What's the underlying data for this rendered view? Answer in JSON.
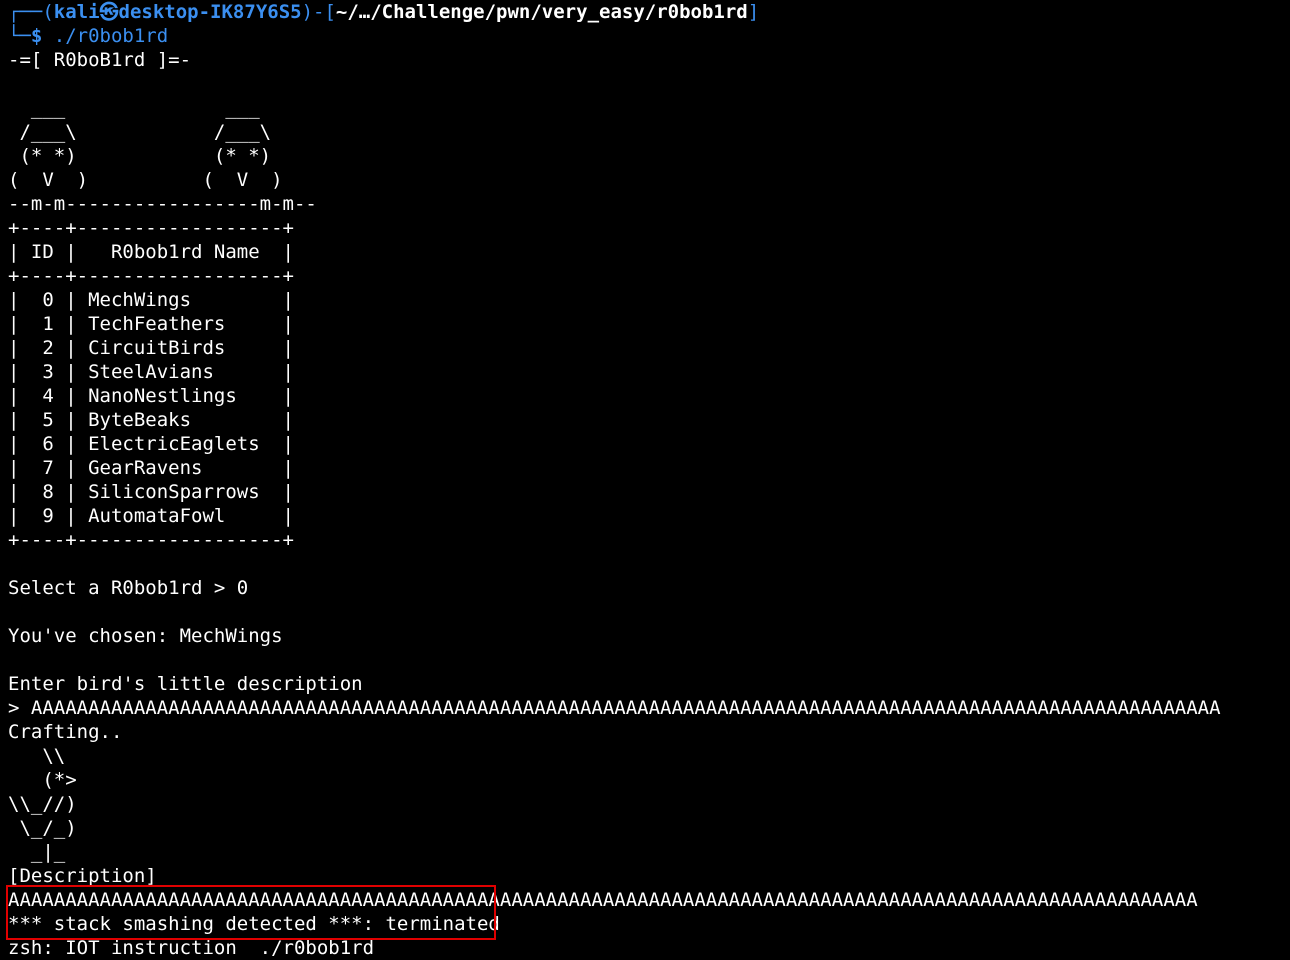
{
  "prompt": {
    "corner_top": "┌──(",
    "user": "kali",
    "at_glyph": "㉿",
    "host": "desktop-IK87Y6S5",
    "sep_open": ")-[",
    "path": "~/…/Challenge/pwn/very_easy/r0bob1rd",
    "sep_close": "]",
    "corner_bottom": "└─",
    "dollar": "$",
    "command": "./r0bob1rd"
  },
  "banner": "-=[ R0boB1rd ]=-",
  "ascii_art": [
    "",
    "  ___              ___",
    " /___\\            /___\\",
    " (* *)            (* *)",
    "(  V  )          (  V  )",
    "--m-m-----------------m-m--"
  ],
  "table": {
    "border": "+----+------------------+",
    "header": "| ID |   R0bob1rd Name  |",
    "rows": [
      "|  0 | MechWings        |",
      "|  1 | TechFeathers     |",
      "|  2 | CircuitBirds     |",
      "|  3 | SteelAvians      |",
      "|  4 | NanoNestlings    |",
      "|  5 | ByteBeaks        |",
      "|  6 | ElectricEaglets  |",
      "|  7 | GearRavens       |",
      "|  8 | SiliconSparrows  |",
      "|  9 | AutomataFowl     |"
    ]
  },
  "interaction": {
    "select_prompt": "Select a R0bob1rd > 0",
    "chosen": "You've chosen: MechWings",
    "enter_desc": "Enter bird's little description",
    "input_line": "> AAAAAAAAAAAAAAAAAAAAAAAAAAAAAAAAAAAAAAAAAAAAAAAAAAAAAAAAAAAAAAAAAAAAAAAAAAAAAAAAAAAAAAAAAAAAAAAAAAAAAAAA",
    "crafting": "Crafting..",
    "bird_art": [
      "   \\\\",
      "   (*>",
      "\\\\_//)",
      " \\_/_)",
      "  _|_"
    ],
    "desc_label": "[Description]",
    "desc_value": "AAAAAAAAAAAAAAAAAAAAAAAAAAAAAAAAAAAAAAAAAAAAAAAAAAAAAAAAAAAAAAAAAAAAAAAAAAAAAAAAAAAAAAAAAAAAAAAAAAAAAAAA"
  },
  "error": {
    "line1": "*** stack smashing detected ***: terminated",
    "line2": "zsh: IOT instruction  ./r0bob1rd"
  },
  "colors": {
    "background": "#000000",
    "text": "#ffffff",
    "prompt_accent": "#3b8ff0",
    "highlight_border": "#e00000"
  }
}
